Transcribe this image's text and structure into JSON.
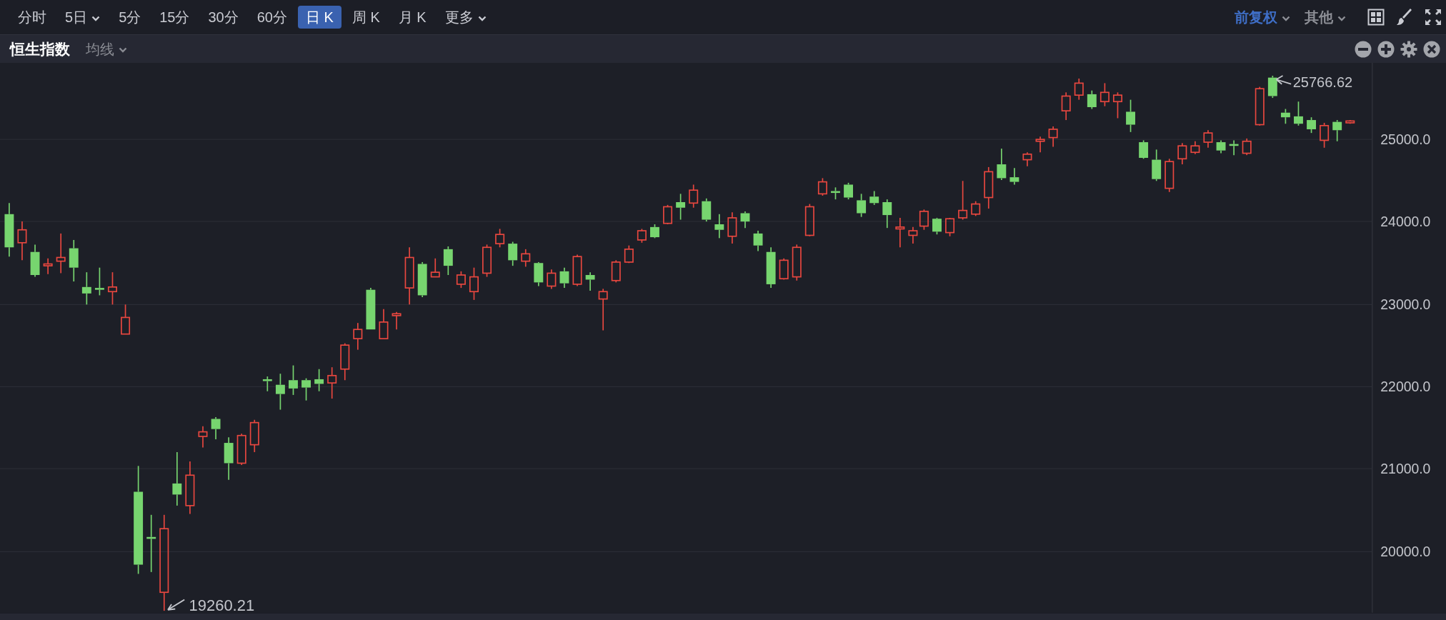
{
  "periods": [
    {
      "label": "分时",
      "selected": false,
      "dropdown": false
    },
    {
      "label": "5日",
      "selected": false,
      "dropdown": true
    },
    {
      "label": "5分",
      "selected": false,
      "dropdown": false
    },
    {
      "label": "15分",
      "selected": false,
      "dropdown": false
    },
    {
      "label": "30分",
      "selected": false,
      "dropdown": false
    },
    {
      "label": "60分",
      "selected": false,
      "dropdown": false
    },
    {
      "label": "日 K",
      "selected": true,
      "dropdown": false
    },
    {
      "label": "周 K",
      "selected": false,
      "dropdown": false
    },
    {
      "label": "月 K",
      "selected": false,
      "dropdown": false
    },
    {
      "label": "更多",
      "selected": false,
      "dropdown": true
    }
  ],
  "menus": [
    {
      "label": "前复权",
      "active": true
    },
    {
      "label": "其他",
      "active": false
    }
  ],
  "chart_header": {
    "title": "恒生指数",
    "indicator": "均线"
  },
  "y_axis": [
    "25000.0",
    "24000.0",
    "23000.0",
    "22000.0",
    "21000.0",
    "20000.0"
  ],
  "annotations": {
    "high": "25766.62",
    "low": "19260.21"
  }
}
